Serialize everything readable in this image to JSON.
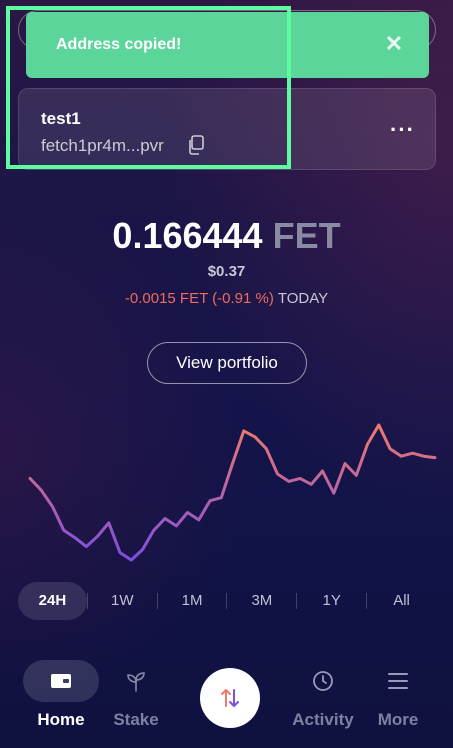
{
  "toast": {
    "message": "Address copied!"
  },
  "account": {
    "name": "test1",
    "address": "fetch1pr4m...pvr"
  },
  "balance": {
    "amount": "0.166444",
    "currency": "FET",
    "usd": "$0.37",
    "change": "-0.0015 FET (-0.91 %)",
    "period": "TODAY"
  },
  "actions": {
    "view_portfolio": "View portfolio"
  },
  "ranges": [
    "24H",
    "1W",
    "1M",
    "3M",
    "1Y",
    "All"
  ],
  "active_range": "24H",
  "nav": {
    "home": "Home",
    "stake": "Stake",
    "activity": "Activity",
    "more": "More"
  },
  "icons": {
    "close": "close-icon",
    "copy": "copy-icon",
    "more": "more-horizontal-icon",
    "wallet": "wallet-icon",
    "stake": "sprout-icon",
    "swap": "swap-arrows-icon",
    "activity": "clock-icon",
    "menu": "menu-icon"
  },
  "colors": {
    "toast": "#5cd59b",
    "negative": "#f06b5f",
    "chart_start": "#7b4fe0",
    "chart_end": "#f07a6a"
  },
  "chart_data": {
    "type": "line",
    "values": [
      0.166,
      0.1652,
      0.1641,
      0.1625,
      0.162,
      0.1614,
      0.1621,
      0.163,
      0.161,
      0.1605,
      0.1612,
      0.1625,
      0.1633,
      0.1628,
      0.1637,
      0.1632,
      0.1645,
      0.1647,
      0.167,
      0.1692,
      0.1688,
      0.168,
      0.1663,
      0.1658,
      0.166,
      0.1656,
      0.1665,
      0.165,
      0.167,
      0.1662,
      0.1683,
      0.1696,
      0.168,
      0.1675,
      0.1677,
      0.1675,
      0.1674
    ]
  }
}
